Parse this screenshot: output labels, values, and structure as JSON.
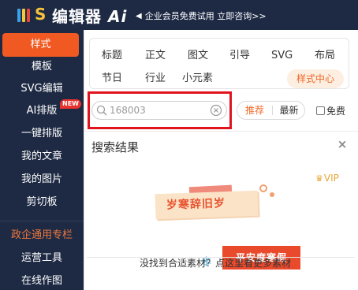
{
  "header": {
    "logo_text": "编辑器",
    "logo_suffix": "Ai",
    "notice": "企业会员免费试用 立即咨询>>"
  },
  "sidebar": {
    "items": [
      {
        "label": "样式"
      },
      {
        "label": "模板"
      },
      {
        "label": "SVG编辑"
      },
      {
        "label": "AI排版",
        "badge": "NEW"
      },
      {
        "label": "一键排版"
      },
      {
        "label": "我的文章"
      },
      {
        "label": "我的图片"
      },
      {
        "label": "剪切板"
      },
      {
        "label": "政企通用专栏"
      },
      {
        "label": "运营工具"
      },
      {
        "label": "在线作图"
      }
    ]
  },
  "categories": {
    "row1": [
      "标题",
      "正文",
      "图文",
      "引导",
      "SVG",
      "布局"
    ],
    "row2": [
      "节日",
      "行业",
      "小元素"
    ],
    "style_center": "样式中心"
  },
  "search": {
    "value": "168003",
    "tabs": [
      "推荐",
      "最新"
    ],
    "free_label": "免费"
  },
  "results": {
    "title": "搜索结果",
    "close": "×",
    "vip_label": "VIP",
    "thumb_card_text": "岁寒辞旧岁",
    "thumb_banner_text": "平安度寒假",
    "empty_message": "没找到合适素材？点这里看更多素材"
  },
  "colors": {
    "sidebar_bg": "#1e2a44",
    "accent": "#f05a22",
    "highlight": "#e1141d"
  }
}
